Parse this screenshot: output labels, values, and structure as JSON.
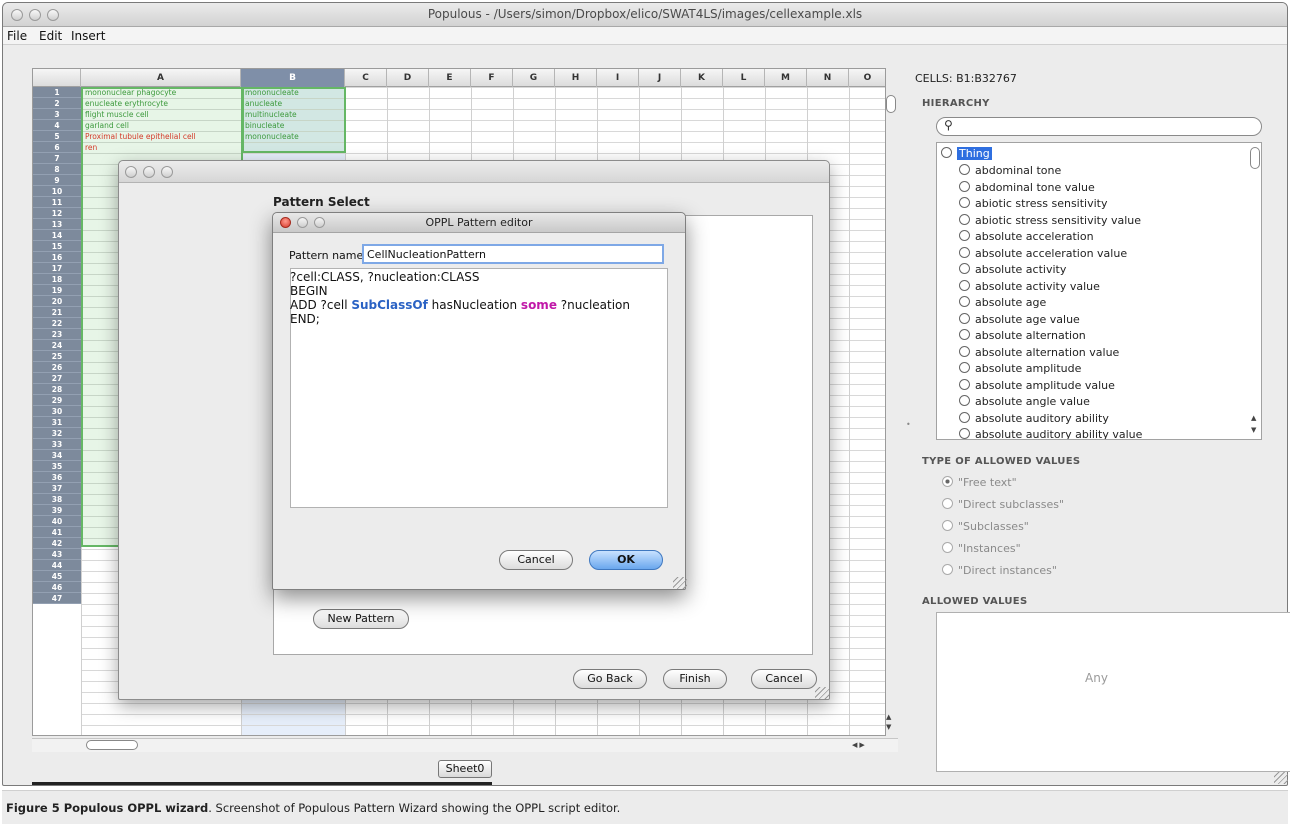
{
  "window": {
    "title": "Populous - /Users/simon/Dropbox/elico/SWAT4LS/images/cellexample.xls"
  },
  "menu": [
    "File",
    "Edit",
    "Insert"
  ],
  "spreadsheet": {
    "columns": [
      "A",
      "B",
      "C",
      "D",
      "E",
      "F",
      "G",
      "H",
      "I",
      "J",
      "K",
      "L",
      "M",
      "N",
      "O"
    ],
    "selected_column": "B",
    "row_count": 47,
    "cells_a": [
      {
        "text": "mononuclear phagocyte",
        "color": "#3d9a3d"
      },
      {
        "text": "enucleate erythrocyte",
        "color": "#3d9a3d"
      },
      {
        "text": "flight muscle cell",
        "color": "#3d9a3d"
      },
      {
        "text": "garland cell",
        "color": "#3d9a3d"
      },
      {
        "text": "Proximal tubule epithelial cell",
        "color": "#d43a2a"
      },
      {
        "text": "ren",
        "color": "#d43a2a"
      }
    ],
    "cells_b": [
      "mononucleate",
      "anucleate",
      "multinucleate",
      "binucleate",
      "mononucleate"
    ],
    "sheet_tab": "Sheet0"
  },
  "right_panel": {
    "cells_label": "CELLS: B1:B32767",
    "hierarchy_title": "HIERARCHY",
    "search_placeholder": "",
    "tree_root": "Thing",
    "tree_items": [
      "abdominal tone",
      "abdominal tone value",
      "abiotic stress sensitivity",
      "abiotic stress sensitivity value",
      "absolute acceleration",
      "absolute acceleration value",
      "absolute activity",
      "absolute activity value",
      "absolute age",
      "absolute age value",
      "absolute alternation",
      "absolute alternation value",
      "absolute amplitude",
      "absolute amplitude value",
      "absolute angle value",
      "absolute auditory ability",
      "absolute auditory ability value"
    ],
    "allowed_type_title": "TYPE OF ALLOWED VALUES",
    "allowed_type_options": [
      "\"Free text\"",
      "\"Direct subclasses\"",
      "\"Subclasses\"",
      "\"Instances\"",
      "\"Direct instances\""
    ],
    "allowed_type_selected": 0,
    "allowed_values_title": "ALLOWED VALUES",
    "allowed_values_placeholder": "Any"
  },
  "pattern_wizard": {
    "heading": "Pattern Select",
    "new_pattern_button": "New Pattern",
    "go_back_button": "Go Back",
    "finish_button": "Finish",
    "cancel_button": "Cancel"
  },
  "oppl_editor": {
    "title": "OPPL Pattern editor",
    "pattern_name_label": "Pattern name",
    "pattern_name_value": "CellNucleationPattern",
    "code": {
      "line1": "?cell:CLASS, ?nucleation:CLASS",
      "line2": "BEGIN",
      "line3_a": "ADD ?cell ",
      "line3_kw1": "SubClassOf",
      "line3_b": " hasNucleation ",
      "line3_kw2": "some",
      "line3_c": " ?nucleation",
      "line4": "END;"
    },
    "cancel_button": "Cancel",
    "ok_button": "OK"
  },
  "caption": {
    "label": "Figure 5 Populous OPPL wizard",
    "text": ". Screenshot of Populous Pattern Wizard showing the OPPL script editor."
  },
  "colors": {
    "selection_green": "#65b765",
    "default_button_blue": "#6aa7ee",
    "keyword_blue": "#2a62c4",
    "keyword_magenta": "#c018a8",
    "row_header": "#7d8a9c"
  }
}
